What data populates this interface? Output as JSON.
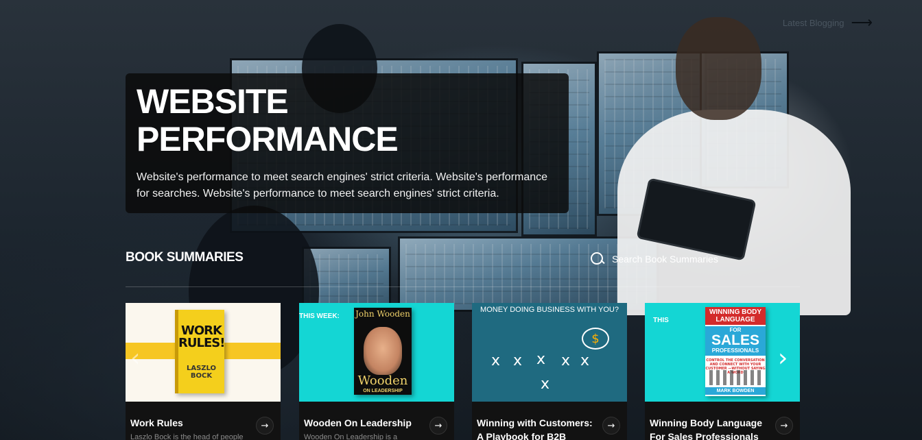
{
  "top_link": {
    "label": "Latest Blogging",
    "arrow_icon": "arrow-right-icon"
  },
  "hero": {
    "title": "WEBSITE PERFORMANCE",
    "description": "Website's performance to meet search engines' strict criteria. Website's performance for searches. Website's performance to meet search engines' strict criteria."
  },
  "section": {
    "title": "BOOK SUMMARIES",
    "search_label": "Search Book Summaries",
    "search_icon": "search-icon"
  },
  "carousel": {
    "prev_icon": "chevron-left-icon",
    "next_icon": "chevron-right-icon",
    "cards": [
      {
        "title": "Work Rules",
        "desc": "Laszlo Bock is the head of people",
        "cover": {
          "line1": "WORK",
          "line2": "RULES!",
          "author": "LASZLO BOCK"
        }
      },
      {
        "title": "Wooden On Leadership",
        "desc": "Wooden On Leadership is a",
        "cover": {
          "tag": "THIS WEEK:",
          "author": "John Wooden",
          "word": "Wooden",
          "sub": "ON LEADERSHIP"
        }
      },
      {
        "title": "Winning with Customers: A Playbook for B2B",
        "desc": "",
        "cover": {
          "question": "MONEY DOING BUSINESS WITH YOU?",
          "mark": "x",
          "symbol": "$"
        }
      },
      {
        "title": "Winning Body Language For Sales Professionals",
        "desc": "",
        "cover": {
          "tag": "THIS",
          "top": "WINNING BODY LANGUAGE",
          "for": "FOR",
          "sales": "SALES",
          "pro": "PROFESSIONALS",
          "blurb": "CONTROL THE CONVERSATION AND CONNECT WITH YOUR CUSTOMER —WITHOUT SAYING A WORD",
          "author": "MARK BOWDEN"
        }
      }
    ],
    "card_arrow": "→"
  },
  "colors": {
    "hero_bg": "#0a0a0a",
    "card_teal": "#14d6d4",
    "card_blue": "#1f6a80",
    "accent_yellow": "#f6c623"
  }
}
